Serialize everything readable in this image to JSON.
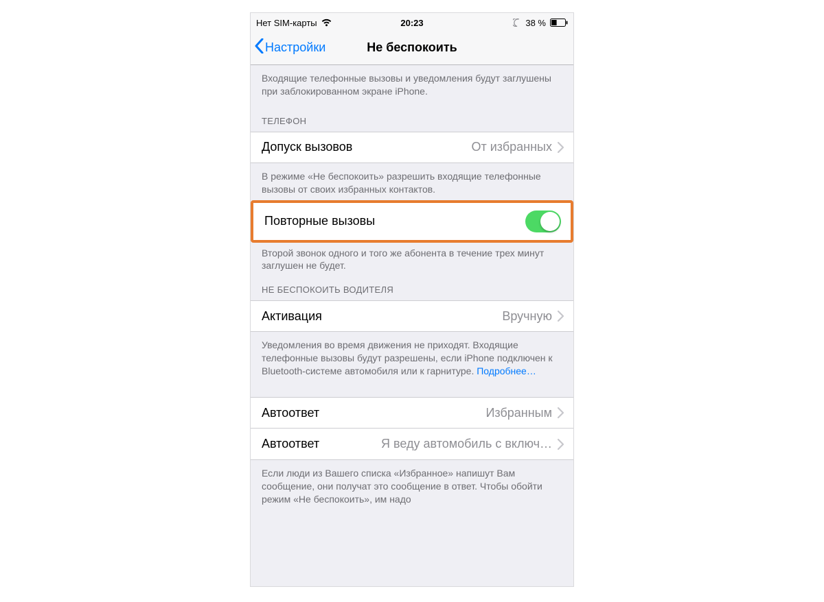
{
  "statusbar": {
    "carrier": "Нет SIM-карты",
    "time": "20:23",
    "battery_pct": "38 %"
  },
  "navbar": {
    "back": "Настройки",
    "title": "Не беспокоить"
  },
  "top_desc": "Входящие телефонные вызовы и уведомления будут заглушены при заблокированном экране iPhone.",
  "phone_section": {
    "header": "ТЕЛЕФОН",
    "allow_calls_label": "Допуск вызовов",
    "allow_calls_value": "От избранных",
    "allow_calls_desc": "В режиме «Не беспокоить» разрешить входящие телефонные вызовы от своих избранных контактов.",
    "repeat_calls_label": "Повторные вызовы",
    "repeat_calls_on": true,
    "repeat_calls_desc": "Второй звонок одного и того же абонента в течение трех минут заглушен не будет."
  },
  "driving_section": {
    "header": "НЕ БЕСПОКОИТЬ ВОДИТЕЛЯ",
    "activation_label": "Активация",
    "activation_value": "Вручную",
    "activation_desc": "Уведомления во время движения не приходят. Входящие телефонные вызовы будут разрешены, если iPhone подключен к Bluetooth-системе автомобиля или к гарнитуре. ",
    "activation_desc_link": "Подробнее…"
  },
  "autoreply_section": {
    "autoreply_to_label": "Автоответ",
    "autoreply_to_value": "Избранным",
    "autoreply_msg_label": "Автоответ",
    "autoreply_msg_value": "Я веду автомобиль с включ…",
    "autoreply_desc": "Если люди из Вашего списка «Избранное» напишут Вам сообщение, они получат это сообщение в ответ. Чтобы обойти режим «Не беспокоить», им надо"
  }
}
